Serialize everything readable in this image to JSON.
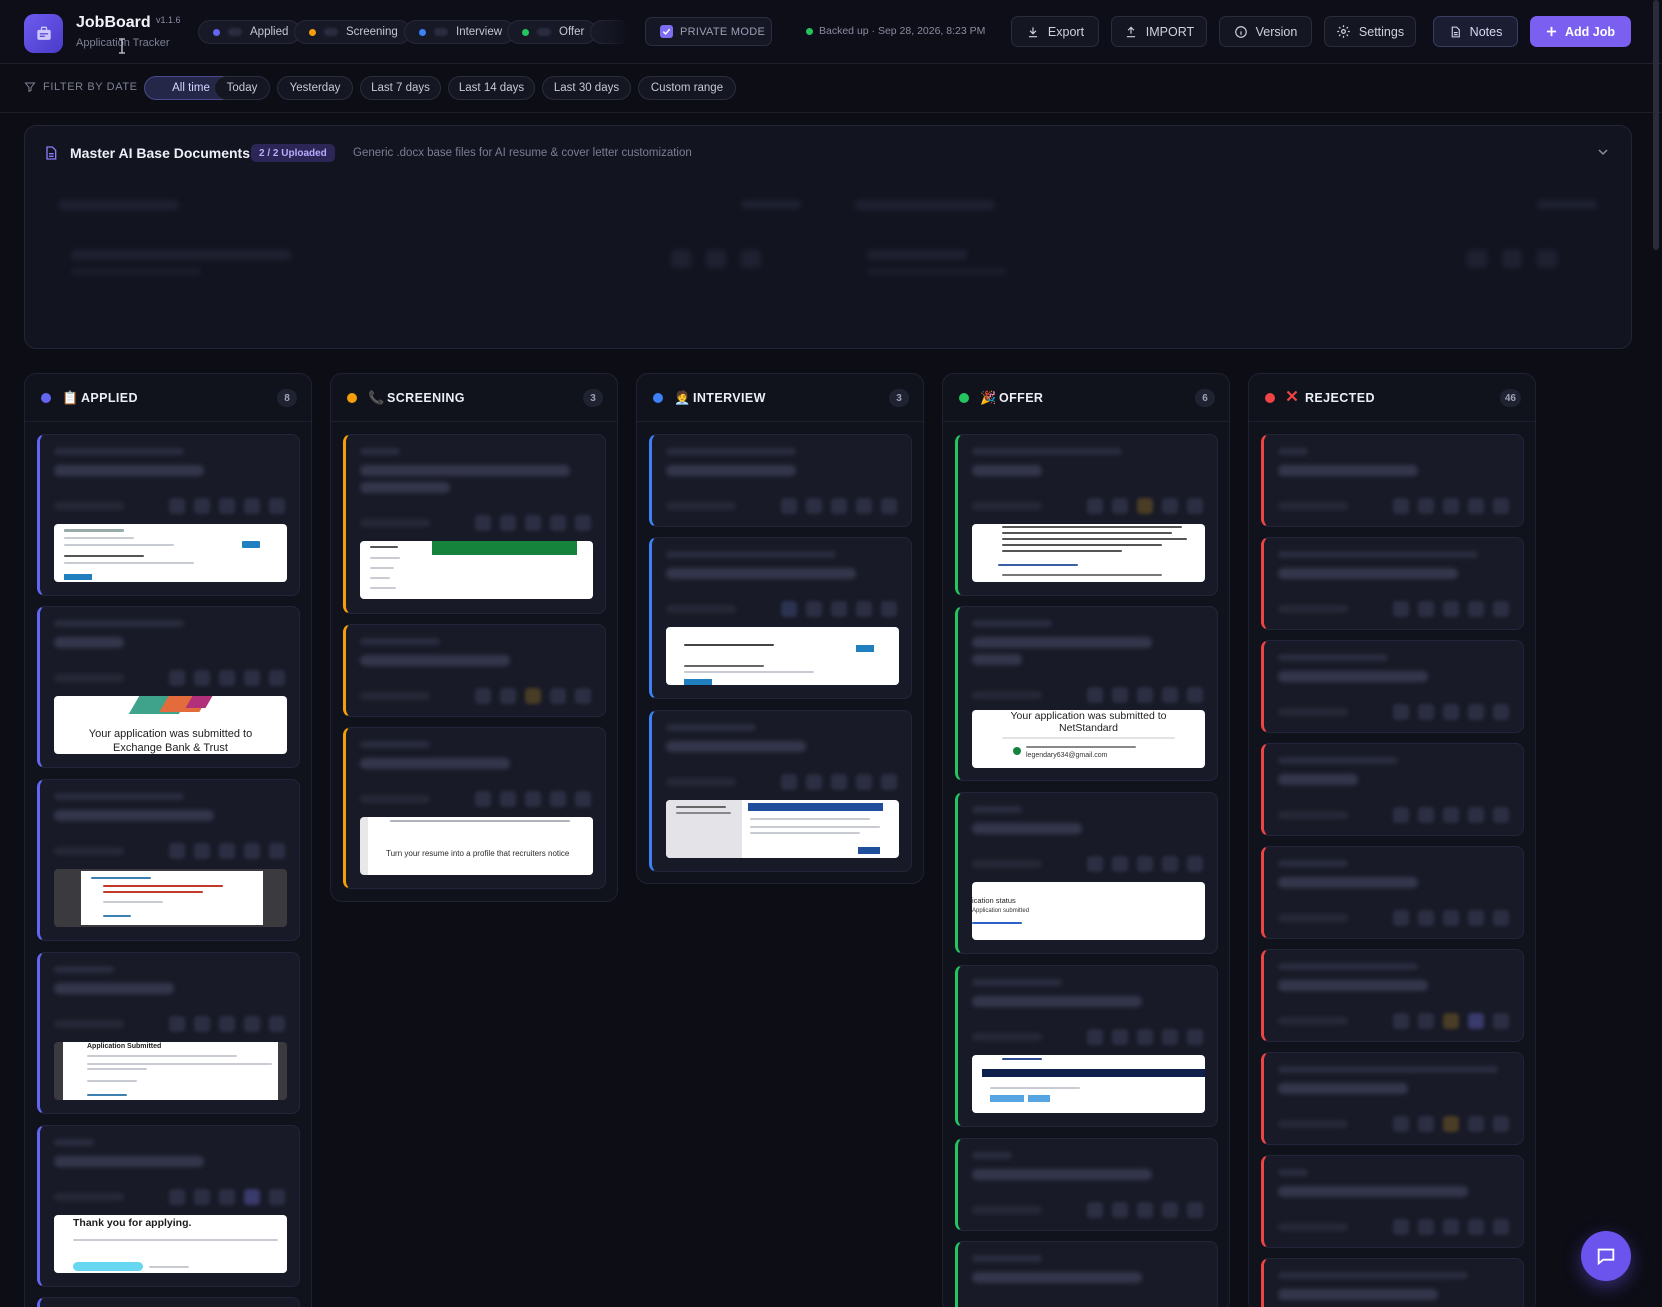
{
  "app": {
    "title": "JobBoard",
    "version": "v1.1.6",
    "subtitle": "Application Tracker"
  },
  "status_pills": [
    {
      "label": "Applied",
      "color": "#6366f1"
    },
    {
      "label": "Screening",
      "color": "#f59e0b"
    },
    {
      "label": "Interview",
      "color": "#3b82f6"
    },
    {
      "label": "Offer",
      "color": "#22c55e"
    },
    {
      "label": "",
      "color": "#ef4444"
    }
  ],
  "private_mode": {
    "label": "PRIVATE MODE",
    "checked": true
  },
  "backup": {
    "text": "Backed up · Sep 28, 2026, 8:23 PM"
  },
  "toolbar": {
    "export": "Export",
    "import": "IMPORT",
    "version": "Version",
    "settings": "Settings",
    "notes": "Notes",
    "add_job": "Add Job"
  },
  "filter": {
    "label": "FILTER BY DATE",
    "options": [
      "All time",
      "Today",
      "Yesterday",
      "Last 7 days",
      "Last 14 days",
      "Last 30 days",
      "Custom range"
    ],
    "active": "All time"
  },
  "master_docs": {
    "title": "Master AI Base Documents",
    "badge": "2 / 2 Uploaded",
    "description": "Generic .docx base files for AI resume & cover letter customization"
  },
  "columns": [
    {
      "key": "applied",
      "title": "APPLIED",
      "count": "8",
      "color": "#6366f1",
      "emoji": "📋"
    },
    {
      "key": "screening",
      "title": "SCREENING",
      "count": "3",
      "color": "#f59e0b",
      "emoji": "📞"
    },
    {
      "key": "interview",
      "title": "INTERVIEW",
      "count": "3",
      "color": "#3b82f6",
      "emoji": "🧑‍💼"
    },
    {
      "key": "offer",
      "title": "OFFER",
      "count": "6",
      "color": "#22c55e",
      "emoji": "🎉"
    },
    {
      "key": "rejected",
      "title": "REJECTED",
      "count": "46",
      "color": "#ef4444",
      "emoji": "❌"
    }
  ],
  "screenshots": {
    "exchange_bank": "Your application was submitted to Exchange Bank & Trust",
    "app_submitted": "Application Submitted",
    "thank_you": "Thank you for applying.",
    "resume_profile": "Turn your resume into a profile that recruiters notice",
    "netstandard": "Your application was submitted to NetStandard",
    "email_hint": "legendary634@gmail.com",
    "app_status": "ication status",
    "app_status_sub": "Application submitted"
  }
}
